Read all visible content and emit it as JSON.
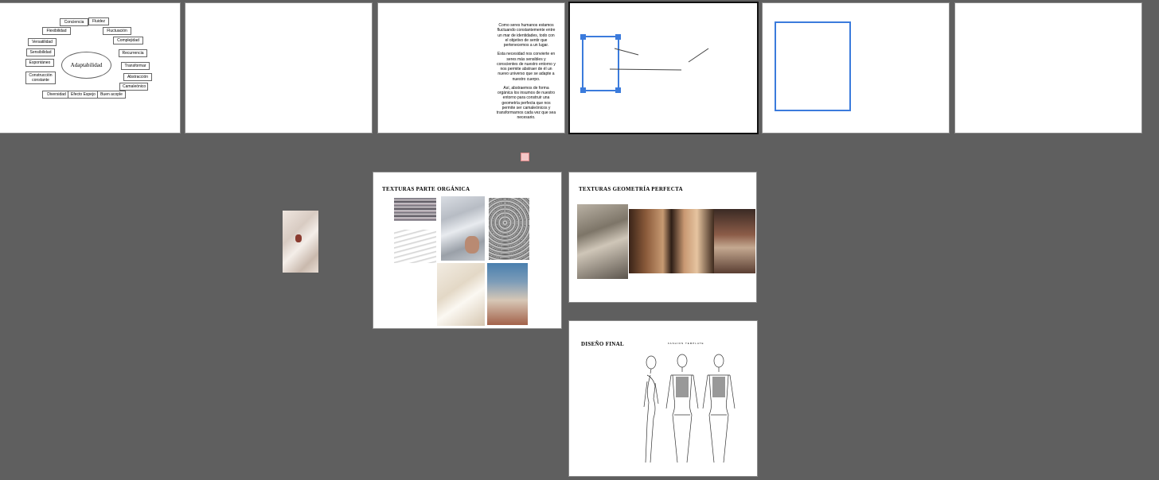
{
  "canvas": {
    "background": "#5f5f5f"
  },
  "selection_color": "#3b7bdc",
  "slide1": {
    "center": "Adaptabilidad",
    "nodes": [
      "Conciencia",
      "Fluidez",
      "Flexibilidad",
      "Fluctuación",
      "Versatilidad",
      "Complejidad",
      "Sensibilidad",
      "Recurrencia",
      "Espontáneo",
      "Transformar",
      "Construcción constante",
      "Abstracción",
      "Camaleónico",
      "Diversidad",
      "Efecto Espejo",
      "Buen acople"
    ]
  },
  "slide3": {
    "paragraphs": [
      "Como seres humanos estamos fluctuando constantemente entre un mar de identidades, todo con el objetivo de sentir que pertenecemos a un lugar.",
      "Esta necesidad nos convierte en seres más sensibles y conscientes de nuestro entorno y nos permite abstraer de él un nuevo universo que se adapte a nuestro cuerpo.",
      "Así, abstraemos de forma orgánica los insumos de nuestro entorno para construir una geometría perfecta que nos permite ser camaleónicos y transformarnos cada vez que sea necesario."
    ]
  },
  "slide_textures_organic": {
    "title": "TEXTURAS PARTE ORGÁNICA"
  },
  "slide_textures_geometry": {
    "title": "TEXTURAS GEOMETRÍA PERFECTA"
  },
  "slide_final": {
    "title": "DISEÑO FINAL",
    "template_label": "FASHION TEMPLATE"
  }
}
